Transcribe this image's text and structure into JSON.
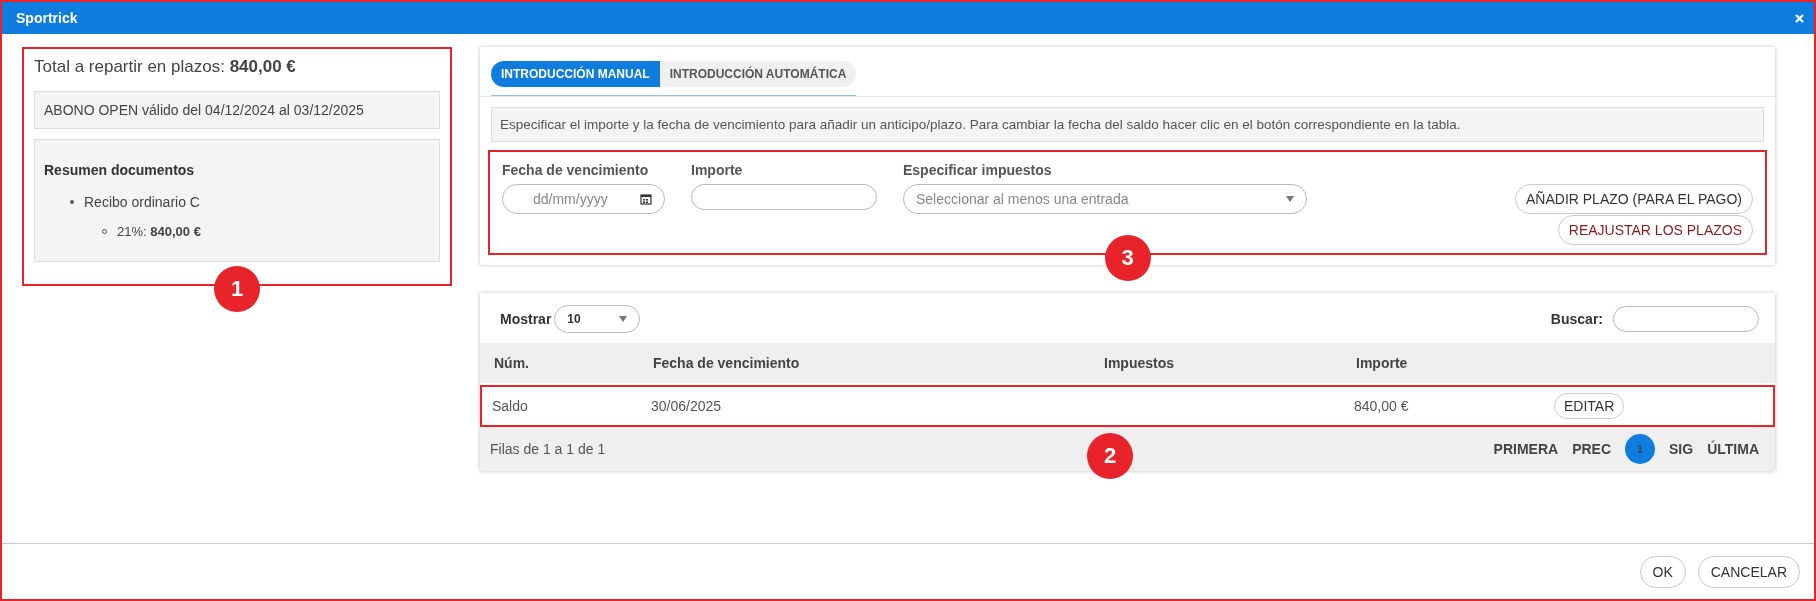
{
  "window": {
    "title": "Sportrick"
  },
  "summary": {
    "total_label": "Total a repartir en plazos:",
    "total_value": "840,00 €",
    "validity": "ABONO OPEN válido del 04/12/2024 al 03/12/2025",
    "documents_title": "Resumen documentos",
    "documents": [
      {
        "name": "Recibo ordinario C",
        "children": [
          {
            "rate": "21%:",
            "amount": "840,00 €"
          }
        ]
      }
    ],
    "callout": "1"
  },
  "tabs": [
    {
      "label": "INTRODUCCIÓN MANUAL",
      "selected": true
    },
    {
      "label": "INTRODUCCIÓN AUTOMÁTICA",
      "selected": false
    }
  ],
  "info": "Especificar el importe y la fecha de vencimiento para añadir un anticipo/plazo. Para cambiar la fecha del saldo hacer clic en el botón correspondiente en la tabla.",
  "form": {
    "fields": [
      {
        "kind": "date",
        "label": "Fecha de vencimiento",
        "placeholder": "dd/mm/yyyy"
      },
      {
        "kind": "text",
        "label": "Importe"
      },
      {
        "kind": "select",
        "label": "Especificar impuestos",
        "placeholder": "Seleccionar al menos una entrada"
      }
    ],
    "buttons": [
      {
        "label": "AÑADIR PLAZO (PARA EL PAGO)",
        "kind": "normal"
      },
      {
        "label": "REAJUSTAR LOS PLAZOS",
        "kind": "danger"
      }
    ],
    "callout": "3"
  },
  "table": {
    "show_label": "Mostrar",
    "page_size": "10",
    "search_label": "Buscar:",
    "columns": [
      "Núm.",
      "Fecha de vencimiento",
      "Impuestos",
      "Importe"
    ],
    "rows": [
      {
        "num": "Saldo",
        "due_date": "30/06/2025",
        "amount": "840,00 €",
        "action": "EDITAR"
      }
    ],
    "info": "Filas de 1 a 1 de 1",
    "pagination": [
      {
        "label": "PRIMERA",
        "selected": false
      },
      {
        "label": "PREC",
        "selected": false
      },
      {
        "label": "1",
        "selected": true
      },
      {
        "label": "SIG",
        "selected": false
      },
      {
        "label": "ÚLTIMA",
        "selected": false
      }
    ],
    "callout": "2"
  },
  "footer": {
    "buttons": [
      "OK",
      "CANCELAR"
    ]
  }
}
